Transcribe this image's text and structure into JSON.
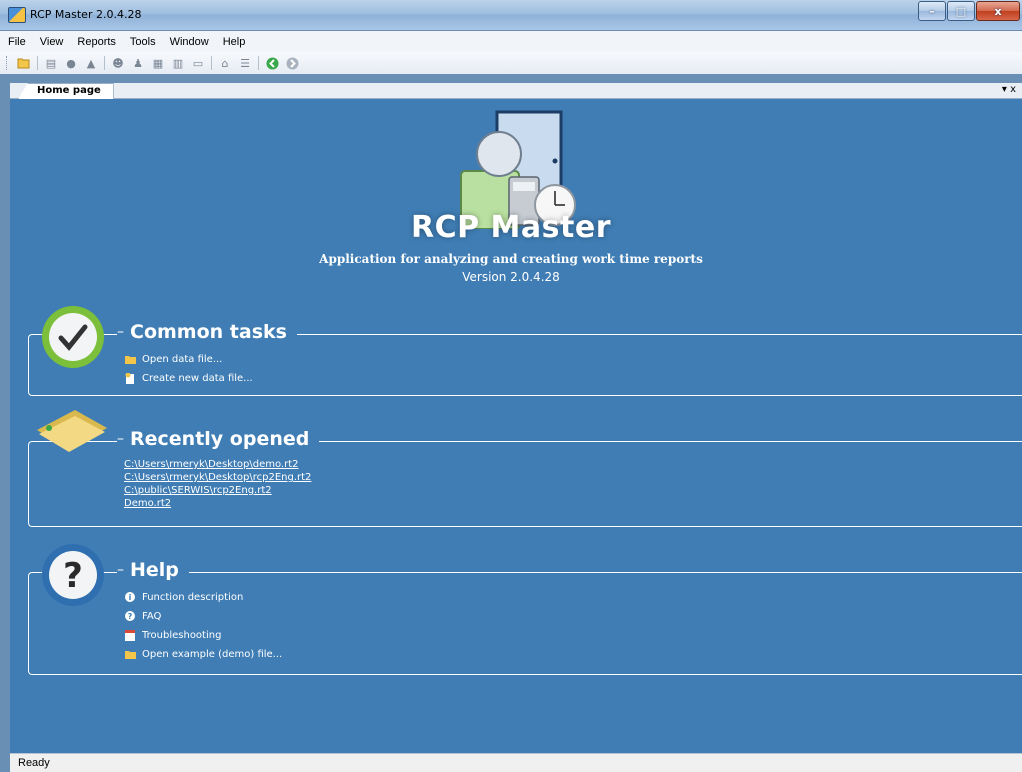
{
  "window": {
    "title": "RCP Master 2.0.4.28",
    "buttons": {
      "minimize": "–",
      "maximize": "□",
      "close": "x"
    }
  },
  "menubar": [
    "File",
    "View",
    "Reports",
    "Tools",
    "Window",
    "Help"
  ],
  "toolbar": {
    "icons": [
      "open-folder-icon",
      "report-icon",
      "info-icon",
      "warning-icon",
      "group-icon",
      "user-icon",
      "calendar-icon",
      "list-icon",
      "table-icon",
      "home-icon",
      "tree-icon",
      "back-icon",
      "forward-icon"
    ]
  },
  "tabs": [
    {
      "label": "Home page"
    }
  ],
  "tab_menu": "▾ x",
  "home": {
    "app_title": "RCP Master",
    "subtitle": "Application for analyzing and creating work time reports",
    "version": "Version 2.0.4.28"
  },
  "sections": {
    "common_tasks": {
      "title": "Common tasks",
      "items": [
        "Open data file...",
        "Create new data file..."
      ]
    },
    "recently_opened": {
      "title": "Recently opened",
      "items": [
        "C:\\Users\\rmeryk\\Desktop\\demo.rt2",
        "C:\\Users\\rmeryk\\Desktop\\rcp2Eng.rt2",
        "C:\\public\\SERWIS\\rcp2Eng.rt2",
        "Demo.rt2"
      ]
    },
    "help": {
      "title": "Help",
      "items": [
        "Function description",
        "FAQ",
        "Troubleshooting",
        "Open example (demo) file..."
      ]
    }
  },
  "status": {
    "text": "Ready"
  },
  "colors": {
    "background": "#3f7db4",
    "titlebar": "#9fbfe0",
    "close_button": "#c0401f"
  }
}
